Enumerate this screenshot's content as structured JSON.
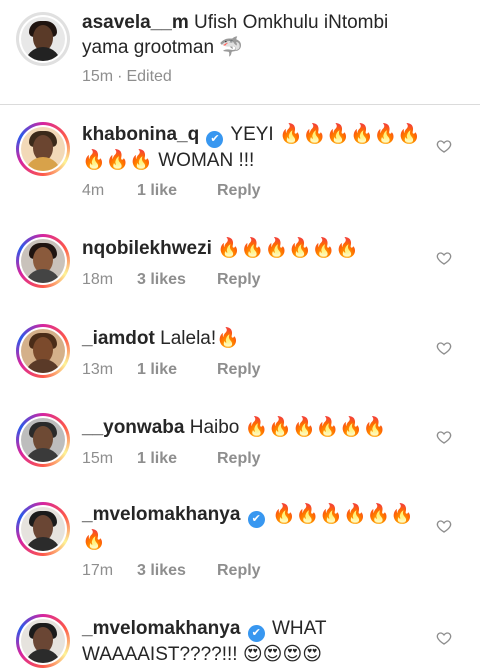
{
  "caption": {
    "username": "asavela__m",
    "text": "Ufish Omkhulu iNtombi yama grootman 🦈",
    "time": "15m",
    "edited_label": "Edited"
  },
  "comments": [
    {
      "username": "khabonina_q",
      "verified": true,
      "text": "YEYI 🔥🔥🔥🔥🔥🔥🔥🔥🔥 WOMAN !!!",
      "time": "4m",
      "likes": "1 like",
      "reply": "Reply"
    },
    {
      "username": "nqobilekhwezi",
      "verified": false,
      "text": "🔥🔥🔥🔥🔥🔥",
      "time": "18m",
      "likes": "3 likes",
      "reply": "Reply"
    },
    {
      "username": "_iamdot",
      "verified": false,
      "text": "Lalela!🔥",
      "time": "13m",
      "likes": "1 like",
      "reply": "Reply"
    },
    {
      "username": "__yonwaba",
      "verified": false,
      "text": "Haibo 🔥🔥🔥🔥🔥🔥",
      "time": "15m",
      "likes": "1 like",
      "reply": "Reply"
    },
    {
      "username": "_mvelomakhanya",
      "verified": true,
      "text": "🔥🔥🔥🔥🔥🔥🔥",
      "time": "17m",
      "likes": "3 likes",
      "reply": "Reply"
    },
    {
      "username": "_mvelomakhanya",
      "verified": true,
      "text": "WHAT WAAAAIST????!!! 😍😍😍😍",
      "time": "",
      "likes": "",
      "reply": ""
    }
  ],
  "colors": {
    "meta_gray": "#8e8e8e",
    "verified_blue": "#3897f0",
    "text": "#262626"
  },
  "icons": {
    "heart": "heart-outline-icon",
    "verified": "verified-badge-icon"
  }
}
